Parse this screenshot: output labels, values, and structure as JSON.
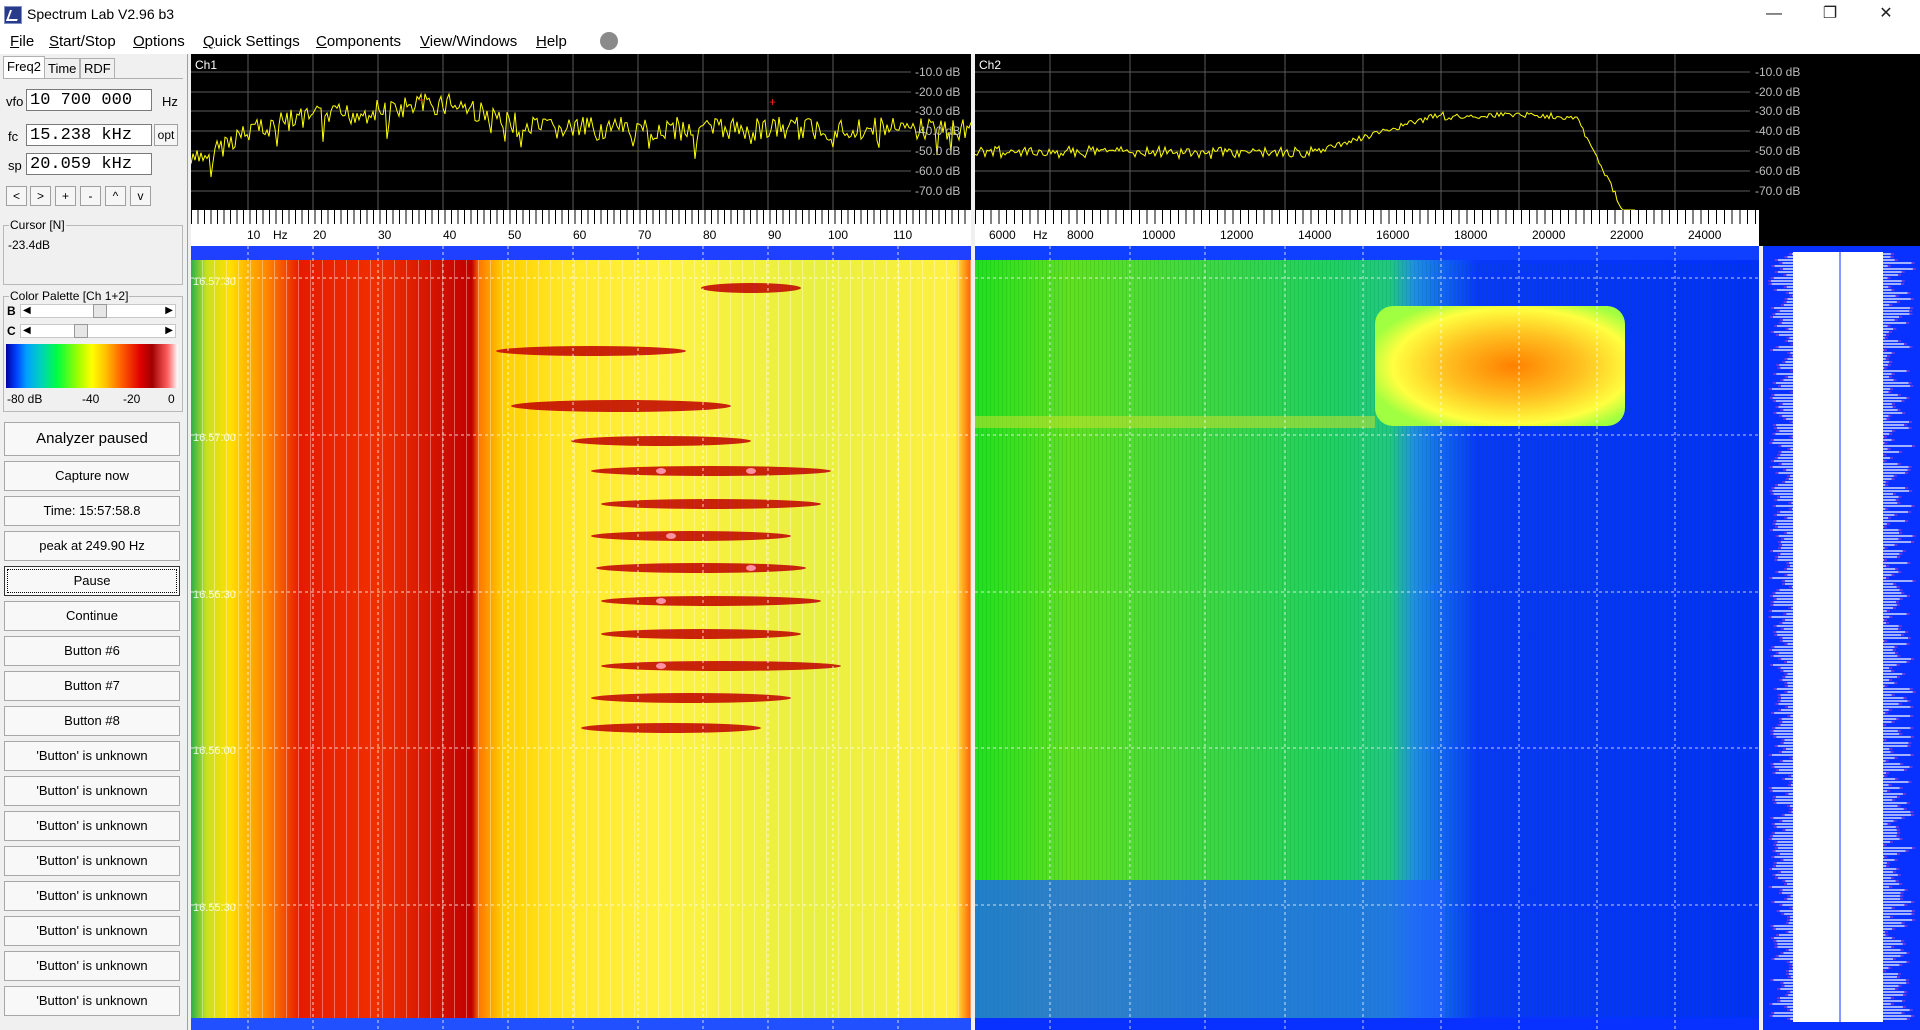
{
  "window": {
    "title": "Spectrum Lab V2.96 b3",
    "minimize_glyph": "—",
    "maximize_glyph": "❐",
    "close_glyph": "✕",
    "app_icon": "spectrum-lab-icon"
  },
  "menu": [
    {
      "label": "File",
      "accel": "F"
    },
    {
      "label": "Start/Stop",
      "accel": "S"
    },
    {
      "label": "Options",
      "accel": "O"
    },
    {
      "label": "Quick Settings",
      "accel": "Q"
    },
    {
      "label": "Components",
      "accel": "C"
    },
    {
      "label": "View/Windows",
      "accel": "V"
    },
    {
      "label": "Help",
      "accel": "H"
    }
  ],
  "tabs": [
    "Freq2",
    "Time",
    "RDF"
  ],
  "freq_controls": {
    "vfo_label": "vfo",
    "vfo_value": "10 700 000",
    "vfo_unit": "Hz",
    "fc_label": "fc",
    "fc_value": "15.238 kHz",
    "opt_label": "opt",
    "sp_label": "sp",
    "sp_value": "20.059 kHz",
    "nav_buttons": [
      "<",
      ">",
      "+",
      "-",
      "^",
      "v"
    ]
  },
  "cursor": {
    "title": "Cursor [N]",
    "value": "-23.4dB"
  },
  "palette": {
    "title": "Color Palette [Ch 1+2]",
    "b_label": "B",
    "c_label": "C",
    "b_level": 0.45,
    "c_level": 0.3,
    "scale": [
      "-80 dB",
      "-40",
      "-20",
      "0"
    ]
  },
  "buttons": [
    "Analyzer paused",
    "Capture now",
    "Time:  15:57:58.8",
    "peak at 249.90 Hz",
    "Pause",
    "Continue",
    "Button #6",
    "Button #7",
    "Button #8",
    "'Button' is unknown",
    "'Button' is unknown",
    "'Button' is unknown",
    "'Button' is unknown",
    "'Button' is unknown",
    "'Button' is unknown",
    "'Button' is unknown",
    "'Button' is unknown"
  ],
  "ch1": {
    "label": "Ch1",
    "db_ticks": [
      "-10.0 dB",
      "-20.0 dB",
      "-30.0 dB",
      "-40.0 dB",
      "-50.0 dB",
      "-60.0 dB",
      "-70.0 dB"
    ],
    "freq_ticks": [
      "10",
      "20",
      "30",
      "40",
      "50",
      "60",
      "70",
      "80",
      "90",
      "100",
      "110"
    ],
    "freq_unit": "Hz",
    "trace_color": "#ffff00"
  },
  "ch2": {
    "label": "Ch2",
    "db_ticks": [
      "-10.0 dB",
      "-20.0 dB",
      "-30.0 dB",
      "-40.0 dB",
      "-50.0 dB",
      "-60.0 dB",
      "-70.0 dB"
    ],
    "freq_ticks": [
      "6000",
      "8000",
      "10000",
      "12000",
      "14000",
      "16000",
      "18000",
      "20000",
      "22000",
      "24000"
    ],
    "freq_unit": "Hz",
    "trace_color": "#ffff00"
  },
  "waterfall_time_labels": [
    "16.57.30",
    "16.57.00",
    "16.56.30",
    "16.56.00",
    "16.55.30"
  ]
}
